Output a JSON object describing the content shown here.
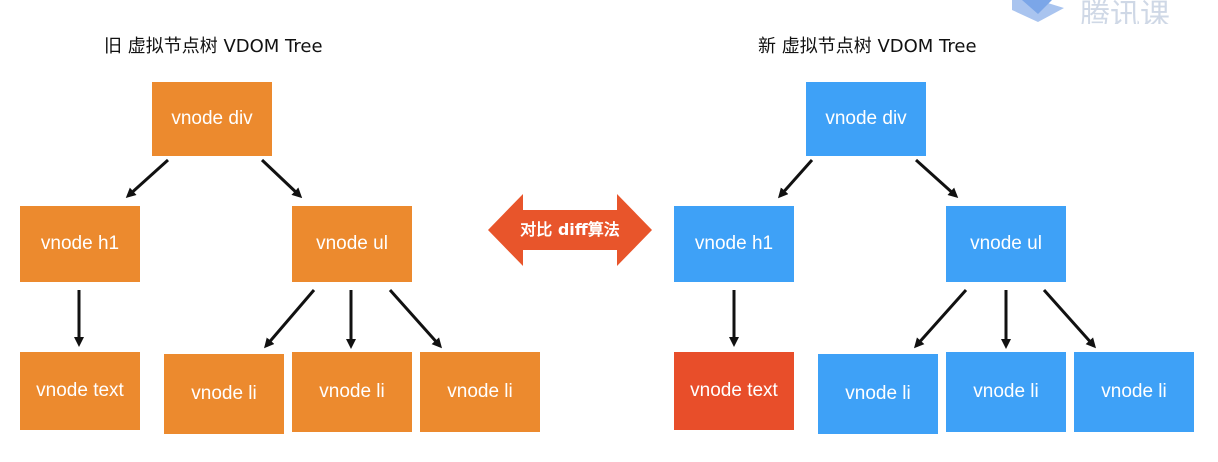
{
  "left_tree": {
    "title": "旧 虚拟节点树 VDOM Tree",
    "root": "vnode div",
    "h1": "vnode h1",
    "ul": "vnode ul",
    "text": "vnode text",
    "li": [
      "vnode li",
      "vnode li",
      "vnode li"
    ]
  },
  "right_tree": {
    "title": "新 虚拟节点树 VDOM Tree",
    "root": "vnode div",
    "h1": "vnode h1",
    "ul": "vnode ul",
    "text": "vnode text",
    "li": [
      "vnode li",
      "vnode li",
      "vnode li"
    ]
  },
  "compare": {
    "label": "对比 diff算法"
  },
  "colors": {
    "old_node": "#EC8A2E",
    "new_node": "#3EA1F7",
    "changed_node": "#E84E2A",
    "compare_arrow": "#E8552B"
  },
  "watermark": {
    "logo_text": "腾讯课"
  }
}
